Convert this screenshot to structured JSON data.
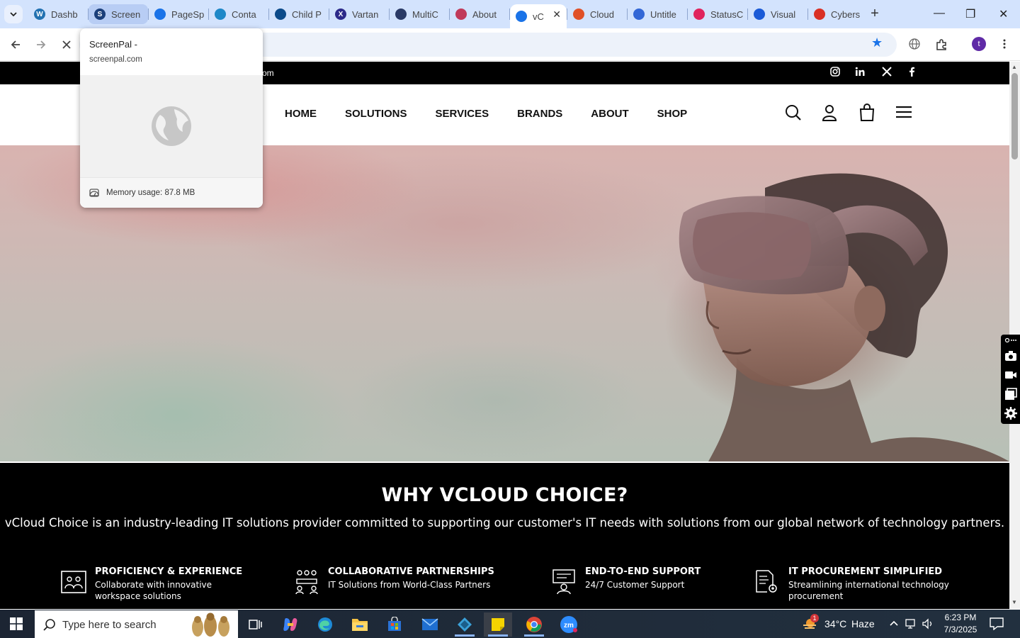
{
  "browser": {
    "tabs": [
      {
        "title": "Dashb",
        "fav_color": "#2271b1",
        "fav_letter": "W",
        "state": "normal"
      },
      {
        "title": "Screen",
        "fav_color": "#1b3f7a",
        "fav_letter": "S",
        "state": "hover"
      },
      {
        "title": "PageSp",
        "fav_color": "#1a73e8",
        "fav_letter": "",
        "state": "normal"
      },
      {
        "title": "Conta",
        "fav_color": "#1e88c8",
        "fav_letter": "",
        "state": "normal"
      },
      {
        "title": "Child P",
        "fav_color": "#0b4a8a",
        "fav_letter": "",
        "state": "normal"
      },
      {
        "title": "Vartan",
        "fav_color": "#2c2a8a",
        "fav_letter": "X",
        "state": "normal"
      },
      {
        "title": "MultiC",
        "fav_color": "#2a3a66",
        "fav_letter": "",
        "state": "normal"
      },
      {
        "title": "About",
        "fav_color": "#c03a5a",
        "fav_letter": "",
        "state": "normal"
      },
      {
        "title": "vC",
        "fav_color": "#1a73e8",
        "fav_letter": "",
        "state": "active"
      },
      {
        "title": "Cloud",
        "fav_color": "#e05028",
        "fav_letter": "",
        "state": "normal"
      },
      {
        "title": "Untitle",
        "fav_color": "#3367d6",
        "fav_letter": "",
        "state": "normal"
      },
      {
        "title": "StatusC",
        "fav_color": "#e0245e",
        "fav_letter": "",
        "state": "normal"
      },
      {
        "title": "Visual",
        "fav_color": "#1a5ad7",
        "fav_letter": "",
        "state": "normal"
      },
      {
        "title": "Cybers",
        "fav_color": "#d93025",
        "fav_letter": "",
        "state": "normal"
      }
    ],
    "new_tab": "+",
    "window_controls": {
      "minimize": "—",
      "maximize": "❐",
      "close": "✕"
    },
    "profile_initial": "t",
    "hover_card": {
      "title": "ScreenPal -",
      "domain": "screenpal.com",
      "memory": "Memory usage: 87.8 MB"
    }
  },
  "site": {
    "topbar_email_fragment": "om",
    "social": [
      "instagram-icon",
      "linkedin-icon",
      "x-icon",
      "facebook-icon"
    ],
    "nav": [
      "HOME",
      "SOLUTIONS",
      "SERVICES",
      "BRANDS",
      "ABOUT",
      "SHOP"
    ],
    "why": {
      "heading": "WHY VCLOUD CHOICE?",
      "lead": "vCloud Choice is an industry-leading IT solutions provider committed to supporting our customer's IT needs with solutions from our global network of technology partners.",
      "features": [
        {
          "title": "PROFICIENCY & EXPERIENCE",
          "desc": "Collaborate with innovative workspace solutions"
        },
        {
          "title": "COLLABORATIVE PARTNERSHIPS",
          "desc": "IT Solutions from World-Class Partners"
        },
        {
          "title": "END-TO-END SUPPORT",
          "desc": "24/7 Customer Support"
        },
        {
          "title": "IT PROCUREMENT SIMPLIFIED",
          "desc": "Streamlining international technology procurement"
        }
      ]
    }
  },
  "taskbar": {
    "search_placeholder": "Type here to search",
    "weather_temp": "34°C",
    "weather_desc": "Haze",
    "weather_badge": "1",
    "time": "6:23 PM",
    "date": "7/3/2025"
  }
}
